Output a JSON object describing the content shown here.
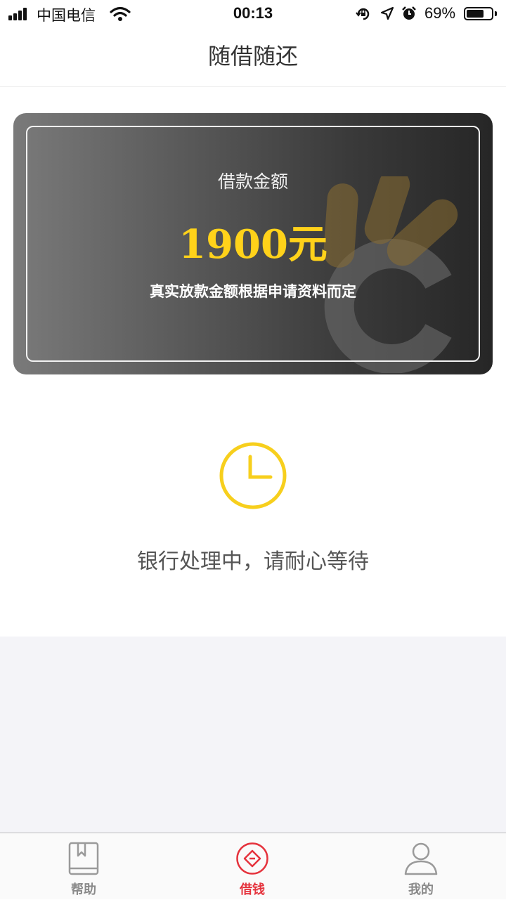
{
  "status_bar": {
    "carrier": "中国电信",
    "time": "00:13",
    "battery_percent": "69%",
    "battery_level": 0.69
  },
  "nav": {
    "title": "随借随还"
  },
  "loan_card": {
    "label": "借款金额",
    "amount": "1900元",
    "note": "真实放款金额根据申请资料而定"
  },
  "processing": {
    "icon": "clock-icon",
    "message": "银行处理中，请耐心等待"
  },
  "tab_bar": {
    "items": [
      {
        "label": "帮助",
        "icon": "book-icon",
        "active": false
      },
      {
        "label": "借钱",
        "icon": "borrow-diamond-icon",
        "active": true
      },
      {
        "label": "我的",
        "icon": "user-icon",
        "active": false
      }
    ]
  },
  "colors": {
    "accent_red": "#e5333d",
    "amount_yellow": "#ffd21a",
    "clock_yellow": "#f7cf1d",
    "grey_bg": "#f4f4f8"
  }
}
